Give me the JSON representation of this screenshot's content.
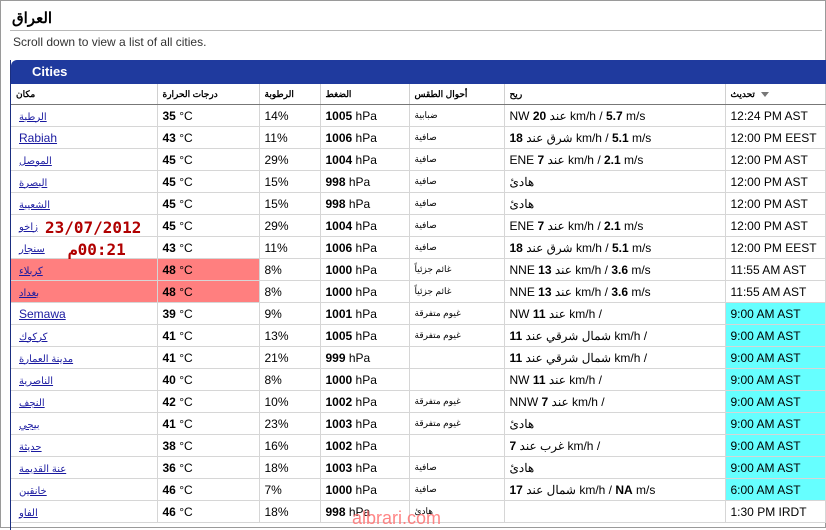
{
  "page": {
    "title": "العراق",
    "subtitle": "Scroll down to view a list of all cities."
  },
  "panel": {
    "title": "Cities"
  },
  "columns": [
    "مكان",
    "درجات الحرارة",
    "الرطوبة",
    "الضغط",
    "أحوال الطقس",
    "ريح",
    "تحديث"
  ],
  "colors": {
    "header_blue": "#1f3a9e",
    "highlight_red": "#ff7f7f",
    "highlight_cyan": "#66ffff",
    "overlay_text": "#b00000"
  },
  "rows": [
    {
      "city": "الرطبة",
      "temp": "35",
      "tunit": "°C",
      "hum": "14%",
      "pres": "1005",
      "punit": "hPa",
      "cond": "ضبابية",
      "wind": "NW <b>20</b> عند km/h / <b>5.7</b> m/s",
      "upd": "12:24 PM AST",
      "hl_city": false,
      "hl_upd": false
    },
    {
      "city": "Rabiah",
      "latin": true,
      "temp": "43",
      "tunit": "°C",
      "hum": "11%",
      "pres": "1006",
      "punit": "hPa",
      "cond": "صافية",
      "wind": "<b>18</b> شرق عند km/h / <b>5.1</b> m/s",
      "upd": "12:00 PM EEST",
      "hl_city": false,
      "hl_upd": false
    },
    {
      "city": "الموصل",
      "temp": "45",
      "tunit": "°C",
      "hum": "29%",
      "pres": "1004",
      "punit": "hPa",
      "cond": "صافية",
      "wind": "ENE <b>7</b> عند km/h / <b>2.1</b> m/s",
      "upd": "12:00 PM AST",
      "hl_city": false,
      "hl_upd": false
    },
    {
      "city": "البصرة",
      "temp": "45",
      "tunit": "°C",
      "hum": "15%",
      "pres": "998",
      "punit": "hPa",
      "cond": "صافية",
      "wind": "هادئ",
      "upd": "12:00 PM AST",
      "hl_city": false,
      "hl_upd": false
    },
    {
      "city": "الشعيبة",
      "temp": "45",
      "tunit": "°C",
      "hum": "15%",
      "pres": "998",
      "punit": "hPa",
      "cond": "صافية",
      "wind": "هادئ",
      "upd": "12:00 PM AST",
      "hl_city": false,
      "hl_upd": false
    },
    {
      "city": "زاخو",
      "temp": "45",
      "tunit": "°C",
      "hum": "29%",
      "pres": "1004",
      "punit": "hPa",
      "cond": "صافية",
      "wind": "ENE <b>7</b> عند km/h / <b>2.1</b> m/s",
      "upd": "12:00 PM AST",
      "hl_city": false,
      "hl_upd": false
    },
    {
      "city": "سنجار",
      "temp": "43",
      "tunit": "°C",
      "hum": "11%",
      "pres": "1006",
      "punit": "hPa",
      "cond": "صافية",
      "wind": "<b>18</b> شرق عند km/h / <b>5.1</b> m/s",
      "upd": "12:00 PM EEST",
      "hl_city": false,
      "hl_upd": false
    },
    {
      "city": "كربلاء",
      "temp": "48",
      "tunit": "°C",
      "hum": "8%",
      "pres": "1000",
      "punit": "hPa",
      "cond": "غائم جزئياً",
      "wind": "NNE <b>13</b> عند km/h / <b>3.6</b> m/s",
      "upd": "11:55 AM AST",
      "hl_city": true,
      "hl_upd": false
    },
    {
      "city": "بغداد",
      "temp": "48",
      "tunit": "°C",
      "hum": "8%",
      "pres": "1000",
      "punit": "hPa",
      "cond": "غائم جزئياً",
      "wind": "NNE <b>13</b> عند km/h / <b>3.6</b> m/s",
      "upd": "11:55 AM AST",
      "hl_city": true,
      "hl_upd": false
    },
    {
      "city": "Semawa",
      "latin": true,
      "temp": "39",
      "tunit": "°C",
      "hum": "9%",
      "pres": "1001",
      "punit": "hPa",
      "cond": "غيوم متفرقة",
      "wind": "NW <b>11</b> عند km/h /",
      "upd": "9:00 AM AST",
      "hl_city": false,
      "hl_upd": true
    },
    {
      "city": "كركوك",
      "temp": "41",
      "tunit": "°C",
      "hum": "13%",
      "pres": "1005",
      "punit": "hPa",
      "cond": "غيوم متفرقة",
      "wind": "<b>11</b> شمال شرقي عند km/h /",
      "upd": "9:00 AM AST",
      "hl_city": false,
      "hl_upd": true
    },
    {
      "city": "مدينة العمارة",
      "temp": "41",
      "tunit": "°C",
      "hum": "21%",
      "pres": "999",
      "punit": "hPa",
      "cond": "",
      "wind": "<b>11</b> شمال شرقي عند km/h /",
      "upd": "9:00 AM AST",
      "hl_city": false,
      "hl_upd": true
    },
    {
      "city": "الناصرية",
      "temp": "40",
      "tunit": "°C",
      "hum": "8%",
      "pres": "1000",
      "punit": "hPa",
      "cond": "",
      "wind": "NW <b>11</b> عند km/h /",
      "upd": "9:00 AM AST",
      "hl_city": false,
      "hl_upd": true
    },
    {
      "city": "النجف",
      "temp": "42",
      "tunit": "°C",
      "hum": "10%",
      "pres": "1002",
      "punit": "hPa",
      "cond": "غيوم متفرقة",
      "wind": "NNW <b>7</b> عند km/h /",
      "upd": "9:00 AM AST",
      "hl_city": false,
      "hl_upd": true
    },
    {
      "city": "بيجي",
      "temp": "41",
      "tunit": "°C",
      "hum": "23%",
      "pres": "1003",
      "punit": "hPa",
      "cond": "غيوم متفرقة",
      "wind": "هادئ",
      "upd": "9:00 AM AST",
      "hl_city": false,
      "hl_upd": true
    },
    {
      "city": "حديثة",
      "temp": "38",
      "tunit": "°C",
      "hum": "16%",
      "pres": "1002",
      "punit": "hPa",
      "cond": "",
      "wind": "<b>7</b> غرب عند km/h /",
      "upd": "9:00 AM AST",
      "hl_city": false,
      "hl_upd": true
    },
    {
      "city": "عنة القديمة",
      "temp": "36",
      "tunit": "°C",
      "hum": "18%",
      "pres": "1003",
      "punit": "hPa",
      "cond": "صافية",
      "wind": "هادئ",
      "upd": "9:00 AM AST",
      "hl_city": false,
      "hl_upd": true
    },
    {
      "city": "خانقين",
      "temp": "46",
      "tunit": "°C",
      "hum": "7%",
      "pres": "1000",
      "punit": "hPa",
      "cond": "صافية",
      "wind": "<b>17</b> شمال عند km/h / <b>NA</b> m/s",
      "upd": "6:00 AM AST",
      "hl_city": false,
      "hl_upd": true
    },
    {
      "city": "الفاو",
      "temp": "46",
      "tunit": "°C",
      "hum": "18%",
      "pres": "998",
      "punit": "hPa",
      "cond": "هادئ",
      "wind": "",
      "upd": "1:30 PM IRDT",
      "hl_city": false,
      "hl_upd": false
    }
  ],
  "overlay": {
    "date": "23/07/2012",
    "time": "12:00م"
  },
  "watermark": "albrari.com"
}
